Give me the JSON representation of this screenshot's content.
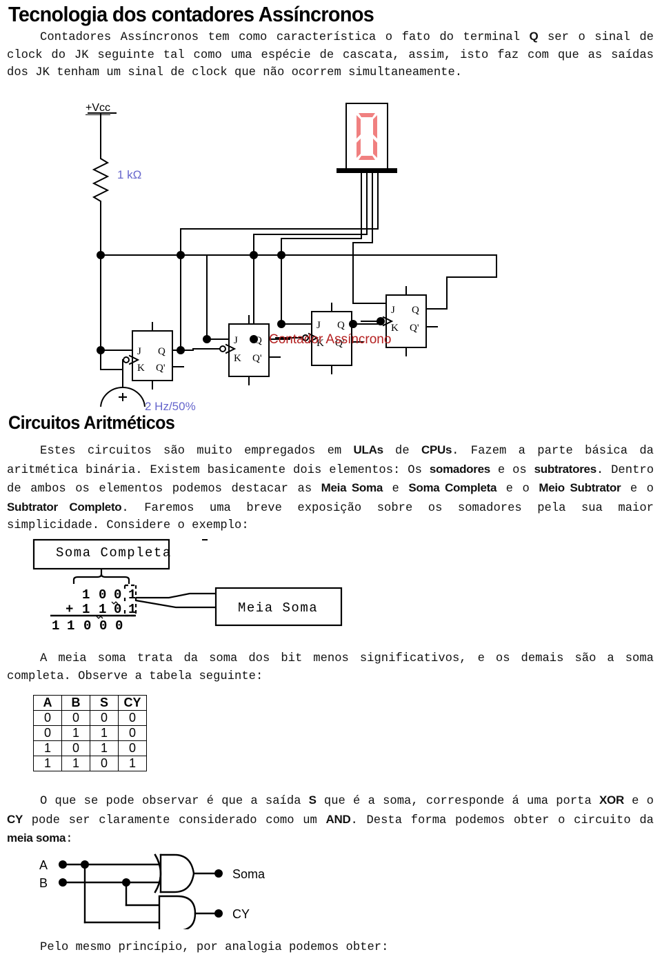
{
  "document": {
    "title": "Tecnologia dos contadores Assíncronos",
    "section_title": "Circuitos Aritméticos"
  },
  "paragraphs": {
    "intro_p1": "Contadores Assíncronos tem como característica o fato do terminal ",
    "intro_q": "Q",
    "intro_p2": " ser o sinal de clock do JK seguinte tal como uma espécie de cascata, assim, isto faz com que as saídas dos JK tenham um sinal de clock que não ocorrem simultaneamente.",
    "arith_1": "Estes circuitos são muito empregados em ",
    "arith_ulas": "ULAs",
    "arith_2": " de ",
    "arith_cpus": "CPUs",
    "arith_3": ". Fazem a parte básica da aritmética binária. Existem basicamente dois elementos: Os ",
    "arith_somadores": "somadores",
    "arith_4": " e os ",
    "arith_subtratores": "subtratores",
    "arith_5": ". Dentro de ambos os elementos podemos destacar as ",
    "arith_meiasoma": "Meia Soma",
    "arith_6": " e ",
    "arith_somacompleta": "Soma Completa",
    "arith_7": " e o ",
    "arith_meiosubtrator": "Meio Subtrator",
    "arith_8": " e o ",
    "arith_subtratorcompleto": "Subtrator Completo",
    "arith_9": ". Faremos uma breve exposição sobre os somadores pela sua maior simplicidade. Considere o exemplo:",
    "meia_soma_desc": "A meia soma trata da soma dos bit menos significativos, e os demais são a soma completa. Observe a tabela seguinte:",
    "observe_1": "O que se pode observar é que a saída ",
    "observe_s": "S",
    "observe_2": " que é a soma, corresponde á uma porta ",
    "observe_xor": "XOR",
    "observe_3": " e o ",
    "observe_cy": "CY",
    "observe_4": " pode ser claramente considerado como um ",
    "observe_and": "AND",
    "observe_5": ". Desta forma podemos obter o circuito da ",
    "observe_meiasoma": "meia soma",
    "observe_6": ":",
    "closing": "Pelo mesmo princípio, por analogia podemos obter:"
  },
  "circuit": {
    "vcc_label": "+Vcc",
    "resistor_label": "1 kΩ",
    "clock_label": "2 Hz/50%",
    "caption": "Contador Assíncrono",
    "display_digit": "0",
    "flipflop_pins": {
      "j": "J",
      "k": "K",
      "q": "Q",
      "qn": "Q'"
    },
    "colors": {
      "annotation": "#6666cc",
      "caption": "#b42020",
      "segment": "#f08080",
      "wire": "#000000"
    }
  },
  "soma_figure": {
    "box_soma_completa": "Soma Completa",
    "box_meia_soma": "Meia Soma",
    "operand1": [
      "1",
      "0",
      "0",
      "1"
    ],
    "operand2": [
      "1",
      "1",
      "0",
      "1"
    ],
    "plus_sign": "+",
    "result": [
      "1",
      "1",
      "0",
      "0",
      "0"
    ]
  },
  "truth_table": {
    "headers": [
      "A",
      "B",
      "S",
      "CY"
    ],
    "rows": [
      [
        "0",
        "0",
        "0",
        "0"
      ],
      [
        "0",
        "1",
        "1",
        "0"
      ],
      [
        "1",
        "0",
        "1",
        "0"
      ],
      [
        "1",
        "1",
        "0",
        "1"
      ]
    ]
  },
  "half_adder": {
    "input_a": "A",
    "input_b": "B",
    "output_soma": "Soma",
    "output_cy": "CY"
  }
}
